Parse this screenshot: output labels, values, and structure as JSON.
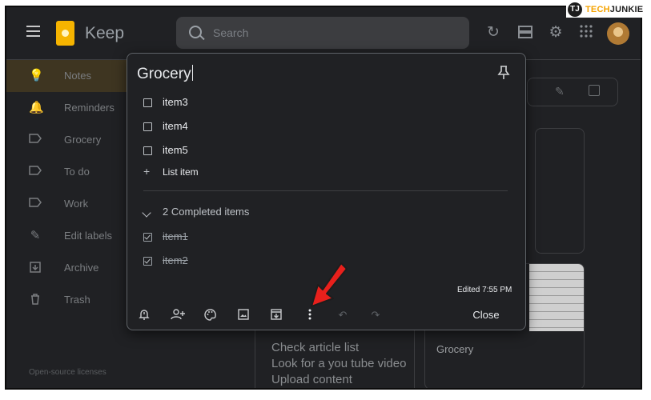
{
  "watermark": {
    "prefix": "TJ",
    "brand_part1": "TECH",
    "brand_part2": "JUNKIE"
  },
  "header": {
    "app_title": "Keep",
    "search_placeholder": "Search",
    "icons": [
      "menu-icon",
      "refresh-icon",
      "list-view-icon",
      "settings-icon",
      "apps-icon",
      "account-avatar"
    ]
  },
  "sidebar": {
    "items": [
      {
        "label": "Notes",
        "icon": "lightbulb-icon",
        "active": true
      },
      {
        "label": "Reminders",
        "icon": "bell-icon"
      },
      {
        "label": "Grocery",
        "icon": "label-icon"
      },
      {
        "label": "To do",
        "icon": "label-icon"
      },
      {
        "label": "Work",
        "icon": "label-icon"
      },
      {
        "label": "Edit labels",
        "icon": "pencil-icon"
      },
      {
        "label": "Archive",
        "icon": "archive-icon"
      },
      {
        "label": "Trash",
        "icon": "trash-icon"
      }
    ],
    "footer": "Open-source licenses"
  },
  "background": {
    "card_grocery_title": "Grocery",
    "card_work_lines": [
      "Check article list",
      "Look for a you tube video",
      "Upload content"
    ]
  },
  "note": {
    "title": "Grocery",
    "items": [
      {
        "text": "item3",
        "checked": false
      },
      {
        "text": "item4",
        "checked": false
      },
      {
        "text": "item5",
        "checked": false
      }
    ],
    "add_item_label": "List item",
    "completed_label": "2 Completed items",
    "completed_items": [
      {
        "text": "item1",
        "checked": true
      },
      {
        "text": "item2",
        "checked": true
      }
    ],
    "edited": "Edited 7:55 PM",
    "toolbar": {
      "icons": [
        "remind-me-icon",
        "collaborator-icon",
        "palette-icon",
        "image-icon",
        "archive-icon",
        "more-options-icon",
        "undo-icon",
        "redo-icon"
      ],
      "close_label": "Close"
    }
  },
  "colors": {
    "background": "#202124",
    "accent_annotation": "#e8201c",
    "logo": "#f6b400"
  }
}
